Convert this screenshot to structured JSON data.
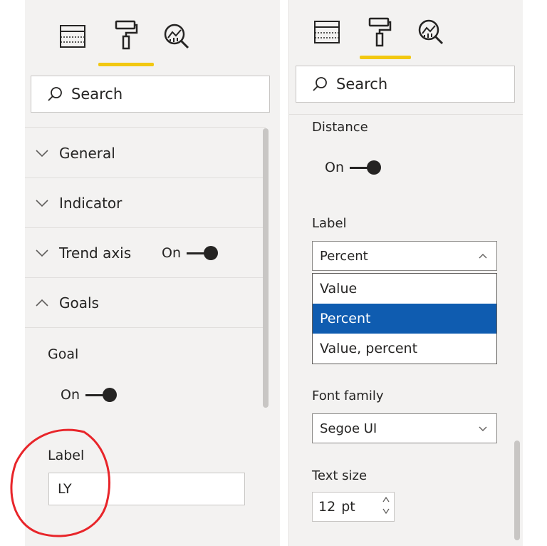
{
  "left_pane": {
    "tabs": [
      {
        "name": "fields",
        "icon": "table-icon"
      },
      {
        "name": "format",
        "icon": "paint-roller-icon",
        "active": true
      },
      {
        "name": "analytics",
        "icon": "analytics-magnifier-icon"
      }
    ],
    "search": {
      "placeholder": "Search"
    },
    "sections": [
      {
        "label": "General",
        "state": "collapsed"
      },
      {
        "label": "Indicator",
        "state": "collapsed"
      },
      {
        "label": "Trend axis",
        "state": "collapsed",
        "toggle": "On"
      },
      {
        "label": "Goals",
        "state": "expanded"
      }
    ],
    "goal": {
      "label": "Goal",
      "toggle": "On"
    },
    "label_field": {
      "label": "Label",
      "value": "LY"
    }
  },
  "right_pane": {
    "tabs": [
      {
        "name": "fields",
        "icon": "table-icon"
      },
      {
        "name": "format",
        "icon": "paint-roller-icon",
        "active": true
      },
      {
        "name": "analytics",
        "icon": "analytics-magnifier-icon"
      }
    ],
    "search": {
      "placeholder": "Search"
    },
    "distance": {
      "label": "Distance",
      "toggle": "On"
    },
    "label_select": {
      "label": "Label",
      "selected": "Percent",
      "options": [
        "Value",
        "Percent",
        "Value, percent"
      ]
    },
    "font_family": {
      "label": "Font family",
      "value": "Segoe UI"
    },
    "text_size": {
      "label": "Text size",
      "value": "12",
      "unit": "pt"
    }
  },
  "colors": {
    "accent": "#f2c811",
    "selection": "#0f5cb0",
    "annotation": "#e8252a",
    "panel_bg": "#f3f2f1"
  }
}
